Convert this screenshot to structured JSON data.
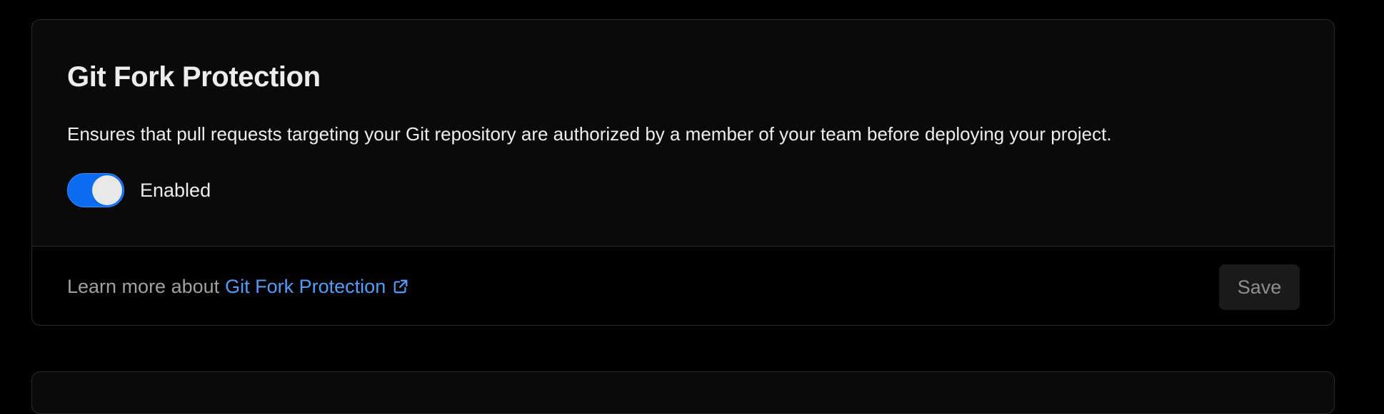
{
  "section": {
    "title": "Git Fork Protection",
    "description": "Ensures that pull requests targeting your Git repository are authorized by a member of your team before deploying your project.",
    "toggle": {
      "state": "on",
      "label": "Enabled"
    }
  },
  "footer": {
    "learn_prefix": "Learn more about",
    "learn_link": "Git Fork Protection",
    "learn_link_icon": "external-link-icon",
    "save_label": "Save"
  },
  "colors": {
    "page_background": "#000000",
    "card_background": "#0a0a0a",
    "border": "#2b2b2b",
    "toggle_on": "#0a6cf0",
    "link": "#4d9eff",
    "muted_text": "#a1a1a1"
  }
}
